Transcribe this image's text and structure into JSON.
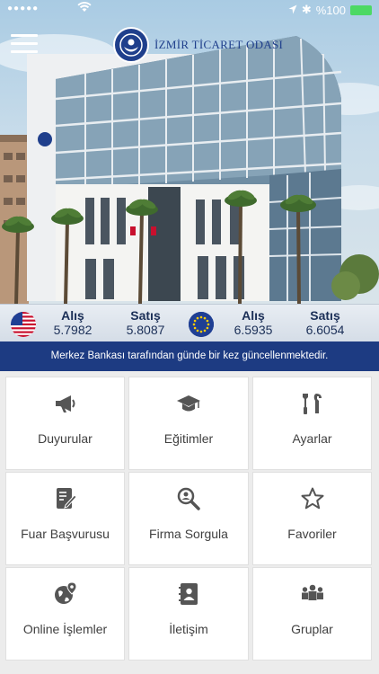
{
  "status_bar": {
    "signal": "●●●●●",
    "wifi": "wifi",
    "time": "",
    "bluetooth": "✱",
    "battery_text": "%100",
    "battery_color": "#4cd964"
  },
  "header": {
    "menu_icon": "hamburger-icon",
    "logo_text": "İZMİR TİCARET ODASI"
  },
  "currency": {
    "usd": {
      "buy_label": "Alış",
      "buy_value": "5.7982",
      "sell_label": "Satış",
      "sell_value": "5.8087"
    },
    "eur": {
      "buy_label": "Alış",
      "buy_value": "6.5935",
      "sell_label": "Satış",
      "sell_value": "6.6054"
    }
  },
  "notice": "Merkez Bankası tarafından günde bir kez güncellenmektedir.",
  "menu": [
    {
      "label": "Duyurular",
      "icon": "megaphone-icon"
    },
    {
      "label": "Eğitimler",
      "icon": "graduation-cap-icon"
    },
    {
      "label": "Ayarlar",
      "icon": "tools-icon"
    },
    {
      "label": "Fuar Başvurusu",
      "icon": "form-icon"
    },
    {
      "label": "Firma Sorgula",
      "icon": "search-icon"
    },
    {
      "label": "Favoriler",
      "icon": "star-icon"
    },
    {
      "label": "Online İşlemler",
      "icon": "globe-pin-icon"
    },
    {
      "label": "İletişim",
      "icon": "address-book-icon"
    },
    {
      "label": "Gruplar",
      "icon": "people-icon"
    }
  ],
  "colors": {
    "brand_blue": "#1d3b82",
    "icon_gray": "#555555",
    "label_gray": "#404040"
  }
}
